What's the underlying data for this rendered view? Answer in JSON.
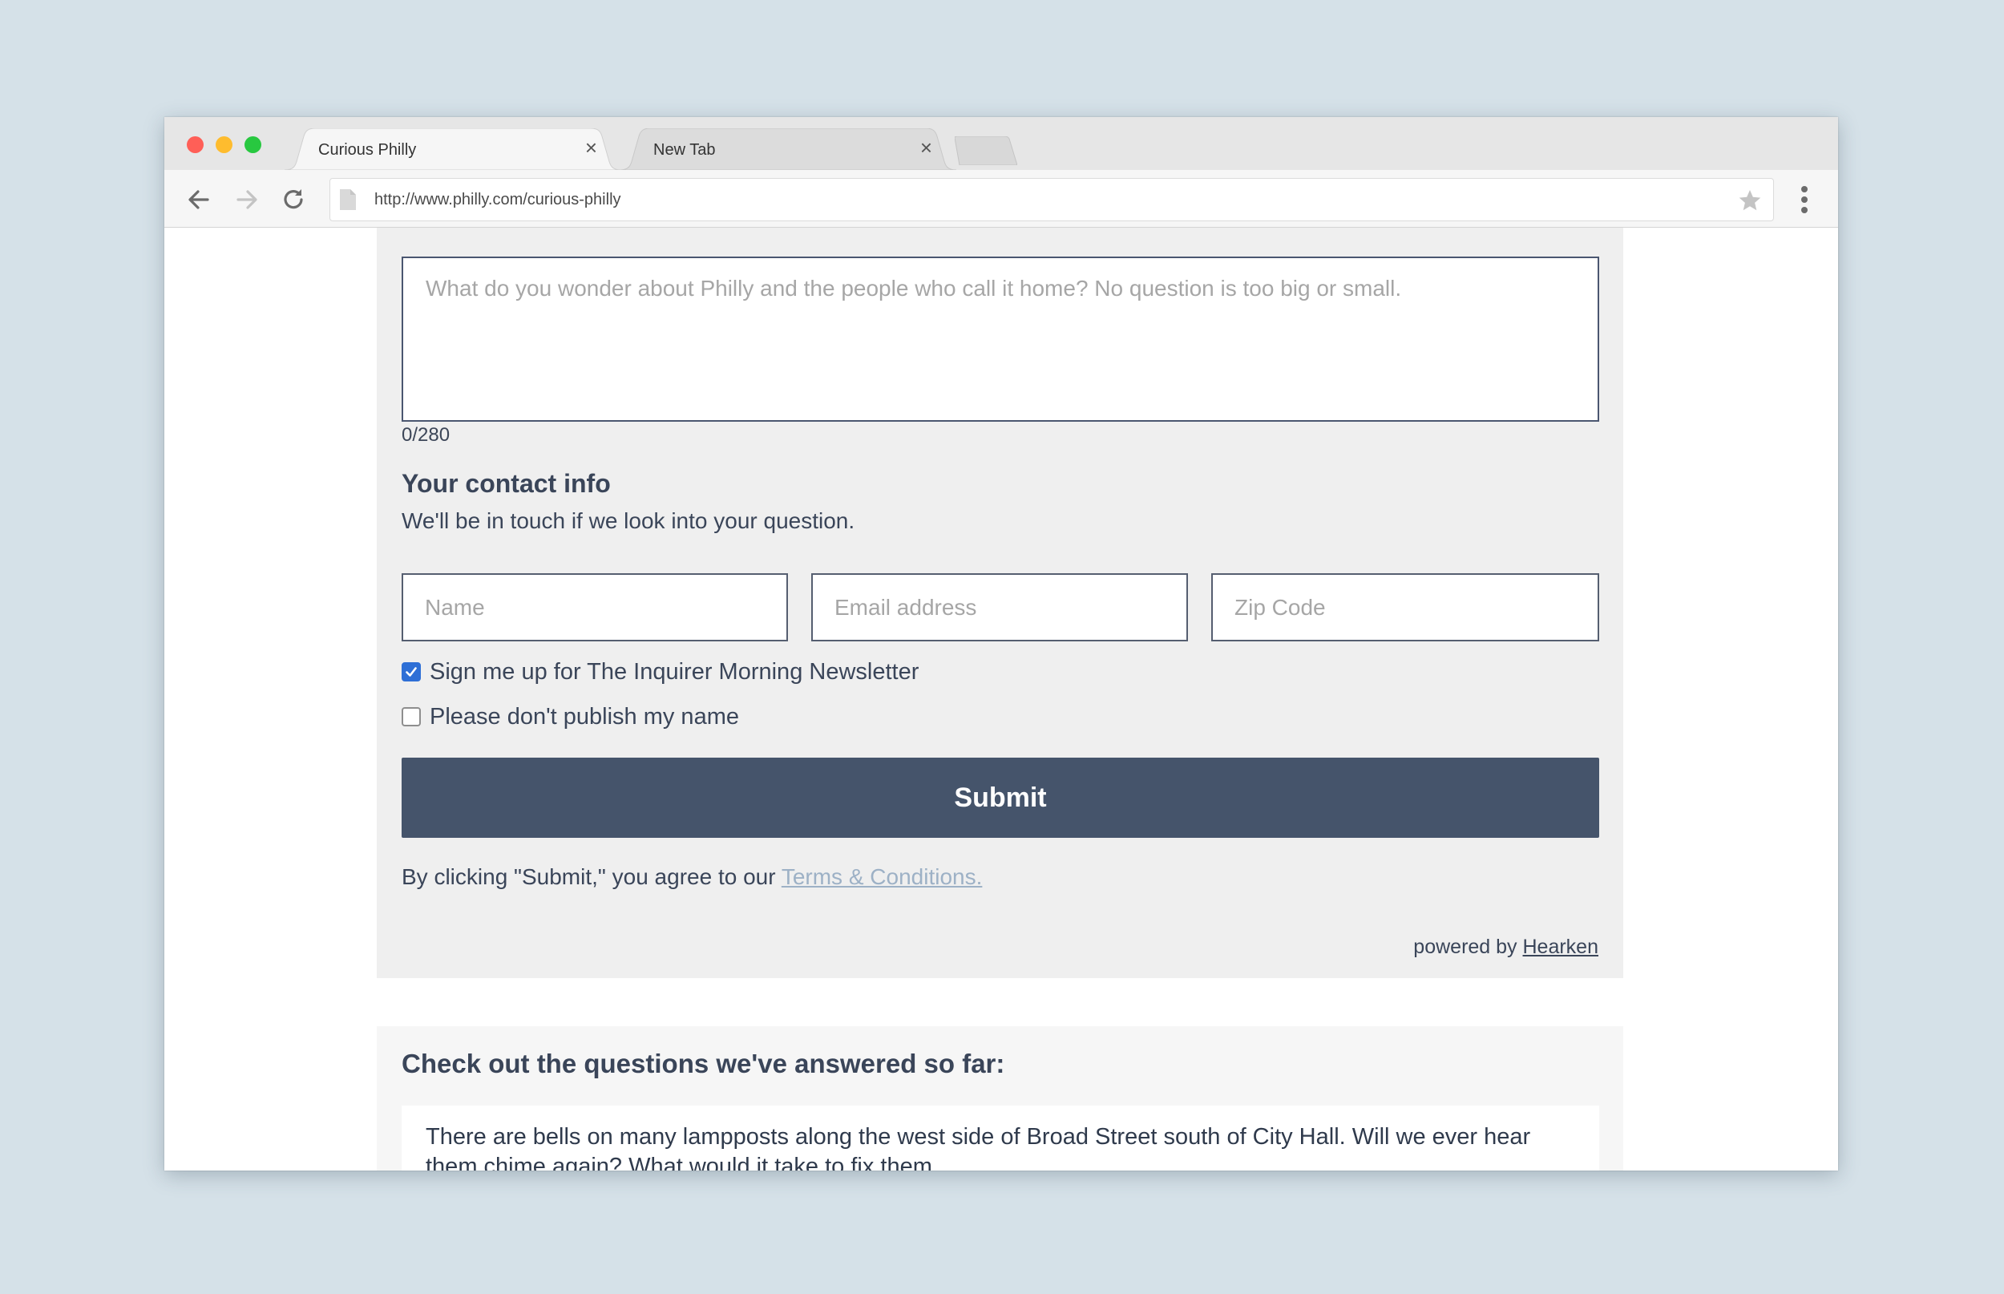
{
  "browser": {
    "tabs": [
      {
        "label": "Curious Philly",
        "close": "×"
      },
      {
        "label": "New Tab",
        "close": "×"
      }
    ],
    "url": "http://www.philly.com/curious-philly",
    "icons": {
      "back": "arrow-left-icon",
      "forward": "arrow-right-icon",
      "reload": "reload-icon",
      "page": "page-icon",
      "bookmark": "star-icon",
      "menu": "kebab-menu-icon"
    }
  },
  "form": {
    "question_placeholder": "What do you wonder about Philly and the people who call it home? No question is too big or small.",
    "counter": "0/280",
    "contact_heading": "Your contact info",
    "contact_subtext": "We'll be in touch if we look into your question.",
    "name_placeholder": "Name",
    "email_placeholder": "Email address",
    "zip_placeholder": "Zip Code",
    "newsletter_label": "Sign me up for The Inquirer Morning Newsletter",
    "newsletter_checked": true,
    "anonymous_label": "Please don't publish my name",
    "anonymous_checked": false,
    "submit_label": "Submit",
    "terms_prefix": "By clicking \"Submit,\" you agree to our",
    "terms_link": "Terms & Conditions.",
    "powered_prefix": "powered by",
    "powered_link": "Hearken"
  },
  "answered": {
    "heading": "Check out the questions we've answered so far:",
    "items": [
      "There are bells on many lampposts along the west side of Broad Street south of City Hall. Will we ever hear them chime again? What would it take to fix them"
    ]
  },
  "colors": {
    "submit_bg": "#45546b",
    "text": "#3a4559",
    "link": "#9db1c6",
    "checkbox": "#2e6fd6",
    "page_bg": "#d5e1e8"
  }
}
